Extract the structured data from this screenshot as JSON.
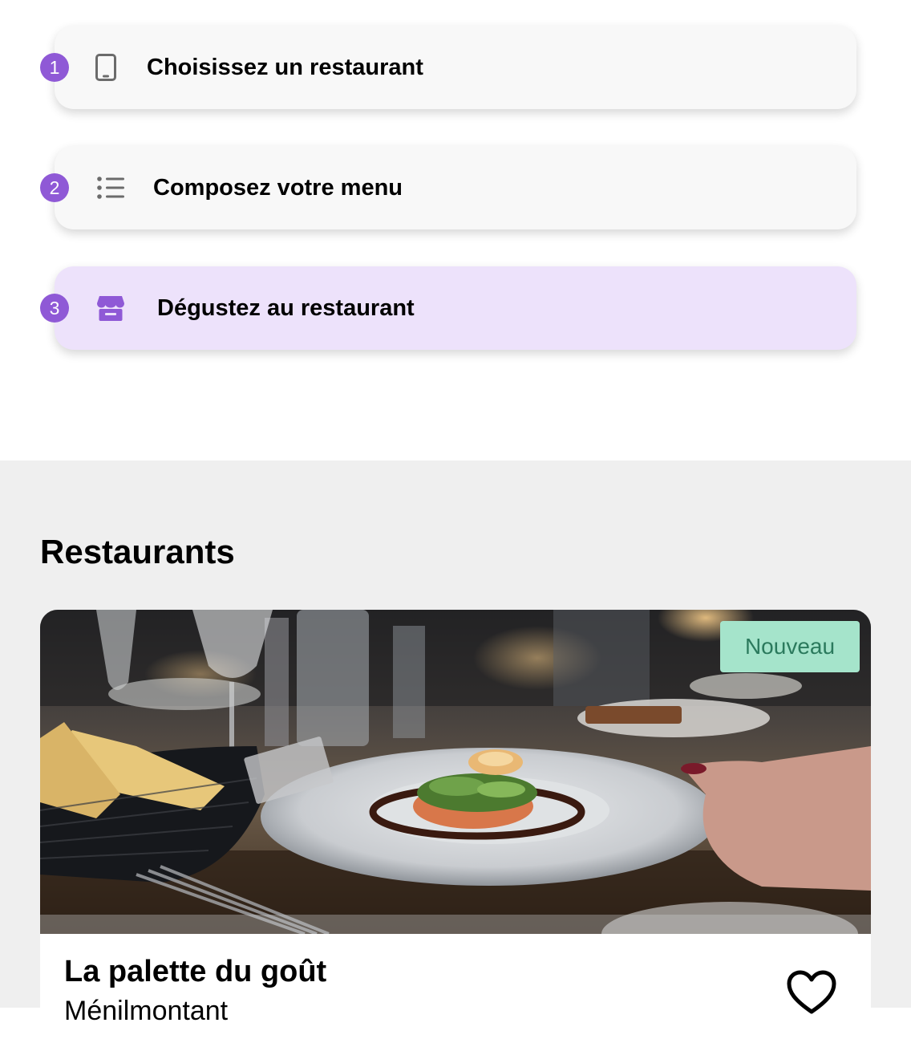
{
  "steps": [
    {
      "number": "1",
      "label": "Choisissez un restaurant",
      "icon": "smartphone-icon"
    },
    {
      "number": "2",
      "label": "Composez votre menu",
      "icon": "list-icon"
    },
    {
      "number": "3",
      "label": "Dégustez au restaurant",
      "icon": "storefront-icon",
      "active": true
    }
  ],
  "restaurants": {
    "title": "Restaurants",
    "cards": [
      {
        "name": "La palette du goût",
        "subtitle": "Ménilmontant",
        "badge": "Nouveau",
        "favorite_icon": "heart-outline-icon"
      }
    ]
  },
  "colors": {
    "accent": "#8f59d6",
    "active_step_bg": "#ede2fb",
    "badge_bg": "#a5e4cb",
    "badge_text": "#2b7a5d",
    "section_bg": "#efefef"
  }
}
